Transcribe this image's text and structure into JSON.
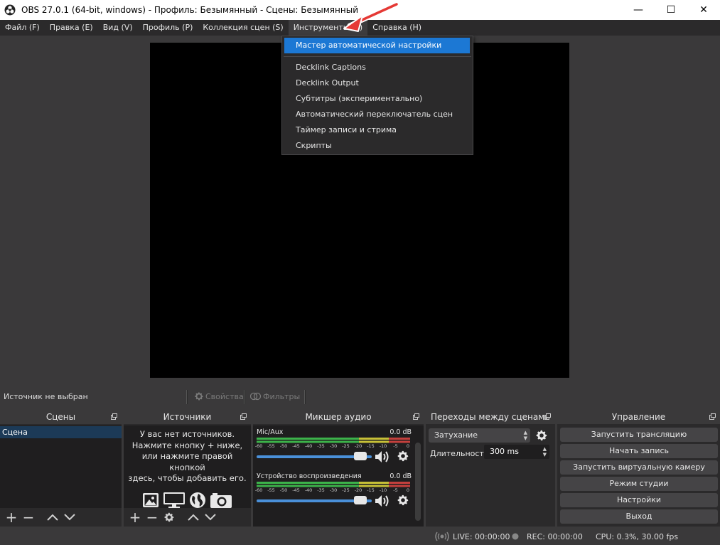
{
  "window": {
    "title": "OBS 27.0.1 (64-bit, windows) - Профиль: Безымянный - Сцены: Безымянный",
    "minimize": "—",
    "maximize": "☐",
    "close": "✕"
  },
  "menubar": [
    "Файл (F)",
    "Правка (E)",
    "Вид (V)",
    "Профиль (P)",
    "Коллекция сцен (S)",
    "Инструменты (T)",
    "Справка (H)"
  ],
  "tools_menu": {
    "highlighted": "Мастер автоматической настройки",
    "items": [
      "Decklink Captions",
      "Decklink Output",
      "Субтитры (экспериментально)",
      "Автоматический переключатель сцен",
      "Таймер записи и стрима",
      "Скрипты"
    ]
  },
  "source_toolbar": {
    "no_source": "Источник не выбран",
    "properties": "Свойства",
    "filters": "Фильтры"
  },
  "docks": {
    "scenes": {
      "title": "Сцены",
      "items": [
        "Сцена"
      ]
    },
    "sources": {
      "title": "Источники",
      "empty": [
        "У вас нет источников.",
        "Нажмите кнопку + ниже,",
        "или нажмите правой кнопкой",
        "здесь, чтобы добавить его."
      ]
    },
    "mixer": {
      "title": "Микшер аудио",
      "channels": [
        {
          "name": "Mic/Aux",
          "db": "0.0 dB",
          "volume": 0.9
        },
        {
          "name": "Устройство воспроизведения",
          "db": "0.0 dB",
          "volume": 0.9
        }
      ],
      "scale": [
        "-60",
        "-55",
        "-50",
        "-45",
        "-40",
        "-35",
        "-30",
        "-25",
        "-20",
        "-15",
        "-10",
        "-5",
        "0"
      ]
    },
    "transitions": {
      "title": "Переходы между сценами",
      "selected": "Затухание",
      "duration_label": "Длительность",
      "duration_value": "300 ms"
    },
    "controls": {
      "title": "Управление",
      "buttons": [
        "Запустить трансляцию",
        "Начать запись",
        "Запустить виртуальную камеру",
        "Режим студии",
        "Настройки",
        "Выход"
      ]
    }
  },
  "status": {
    "live": "LIVE: 00:00:00",
    "rec": "REC: 00:00:00",
    "cpu": "CPU: 0.3%, 30.00 fps"
  },
  "colors": {
    "accent": "#1c78d4",
    "meter_green": "#3cb34a",
    "meter_yellow": "#c7c037",
    "meter_red": "#c4403d",
    "annotation": "#e53935"
  }
}
